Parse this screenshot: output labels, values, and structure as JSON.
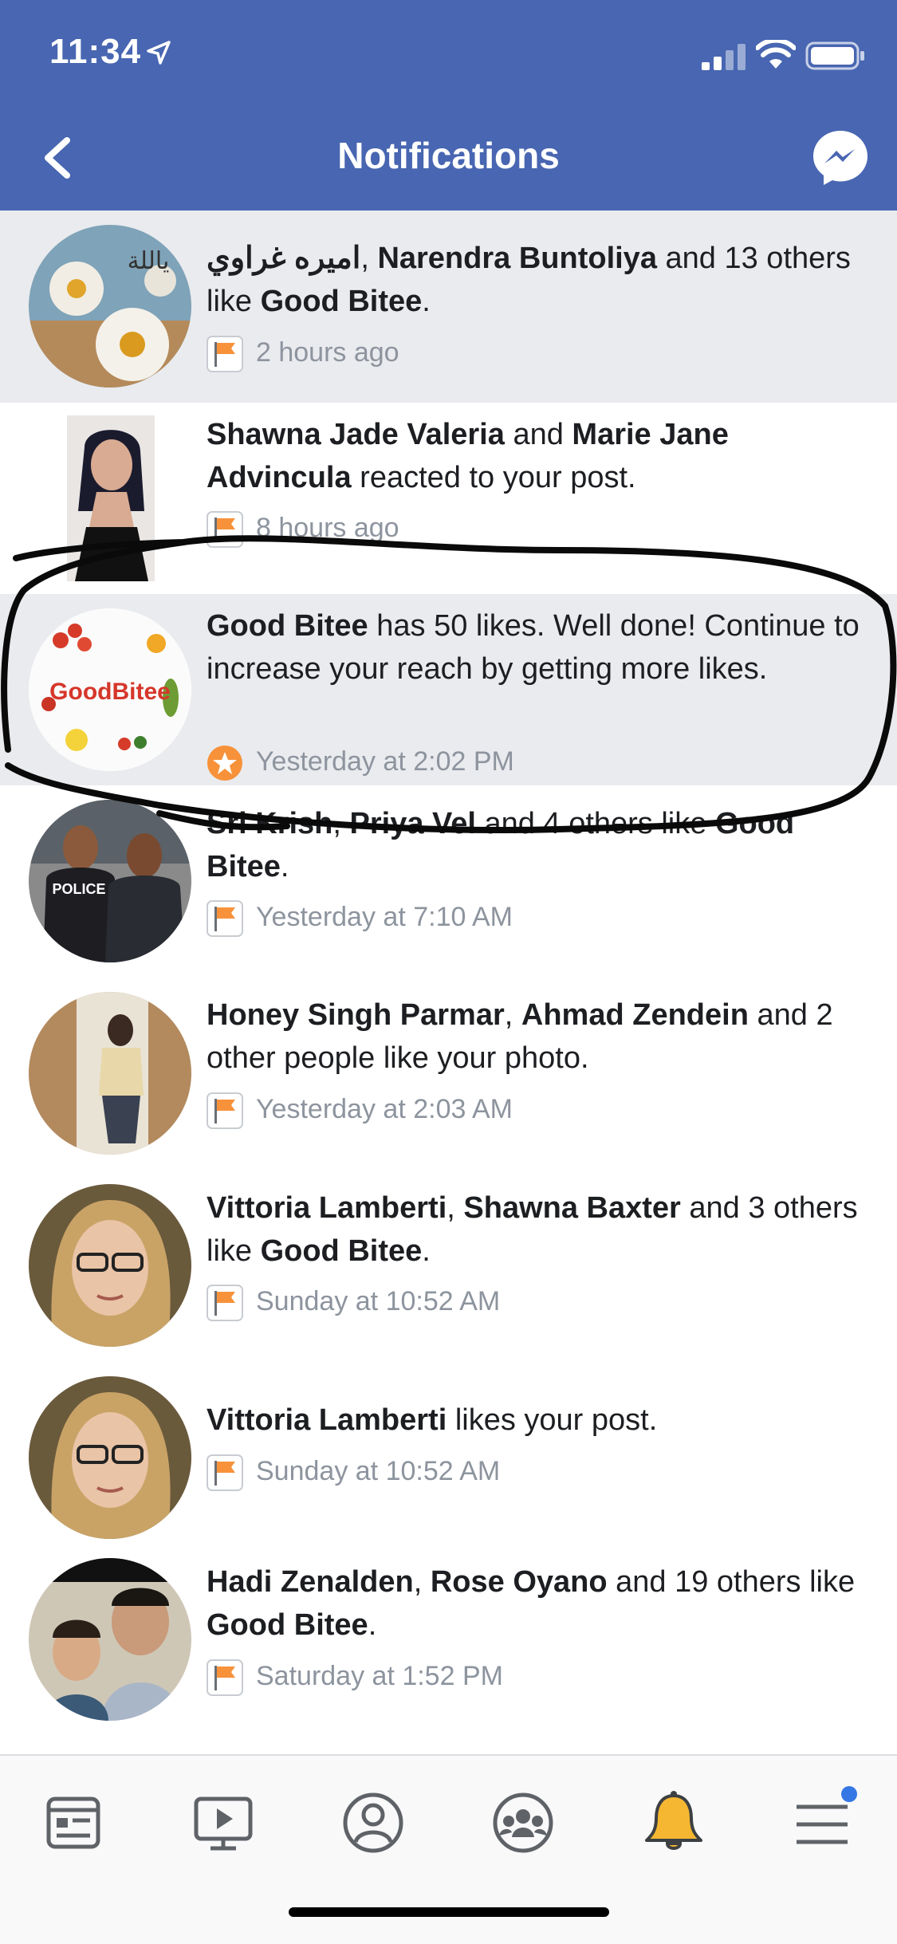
{
  "status_bar": {
    "time": "11:34"
  },
  "header": {
    "title": "Notifications"
  },
  "notifications": [
    {
      "actor1": "اميره غراوي",
      "sep1": ", ",
      "actor2": "Narendra Buntoliya",
      "rest1": " and 13 others like ",
      "page": "Good Bitee",
      "rest2": ".",
      "time": "2 hours ago",
      "badge": "flag-icon",
      "unread": true
    },
    {
      "actor1": "Shawna Jade Valeria",
      "sep1": " and ",
      "actor2": "Marie Jane Advincula",
      "rest1": " reacted to your post.",
      "time": "8 hours ago",
      "badge": "flag-icon",
      "unread": false
    },
    {
      "actor1": "Good Bitee",
      "rest1": " has 50 likes. Well done! Continue to increase your reach by getting more likes.",
      "time": "Yesterday at 2:02 PM",
      "badge": "star-icon",
      "unread": true,
      "avatar_text": "GoodBitee"
    },
    {
      "actor1": "Sri Krish",
      "sep1": ", ",
      "actor2": "Priya Vel",
      "rest1": " and 4 others like ",
      "page": "Good Bitee",
      "rest2": ".",
      "time": "Yesterday at 7:10 AM",
      "badge": "flag-icon",
      "unread": false,
      "avatar_text": "POLICE"
    },
    {
      "actor1": "Honey Singh Parmar",
      "sep1": ", ",
      "actor2": "Ahmad Zendein",
      "rest1": " and 2 other people like your photo.",
      "time": "Yesterday at 2:03 AM",
      "badge": "flag-icon",
      "unread": false
    },
    {
      "actor1": "Vittoria Lamberti",
      "sep1": ", ",
      "actor2": "Shawna Baxter",
      "rest1": " and 3 others like ",
      "page": "Good Bitee",
      "rest2": ".",
      "time": "Sunday at 10:52 AM",
      "badge": "flag-icon",
      "unread": false
    },
    {
      "actor1": "Vittoria Lamberti",
      "rest1": " likes your post.",
      "time": "Sunday at 10:52 AM",
      "badge": "flag-icon",
      "unread": false
    },
    {
      "actor1": "Hadi Zenalden",
      "sep1": ", ",
      "actor2": "Rose Oyano",
      "rest1": " and 19 others like ",
      "page": "Good Bitee",
      "rest2": ".",
      "time": "Saturday at 1:52 PM",
      "badge": "flag-icon",
      "unread": false
    }
  ],
  "tabbar": {
    "items": [
      {
        "icon": "news-feed-icon",
        "active": false
      },
      {
        "icon": "watch-icon",
        "active": false
      },
      {
        "icon": "profile-icon",
        "active": false
      },
      {
        "icon": "groups-icon",
        "active": false
      },
      {
        "icon": "bell-icon",
        "active": true
      },
      {
        "icon": "menu-icon",
        "active": false,
        "badge_dot": true
      }
    ]
  },
  "colors": {
    "header_bg": "#4866b1",
    "unread_bg": "#e9ebee",
    "timestamp": "#8d949e",
    "flag_orange": "#f7923a",
    "bell_yellow": "#f5b731",
    "badge_blue": "#3578e5"
  }
}
